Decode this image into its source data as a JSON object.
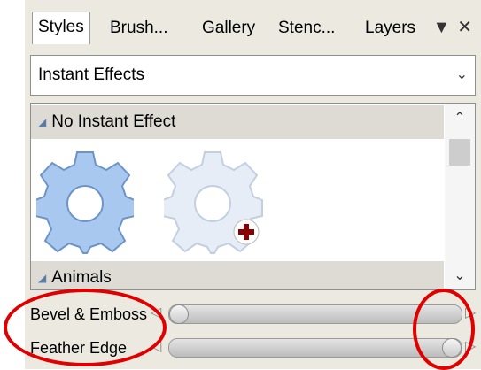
{
  "tabs": [
    {
      "label": "Styles",
      "active": true
    },
    {
      "label": "Brush...",
      "active": false
    },
    {
      "label": "Gallery",
      "active": false
    },
    {
      "label": "Stenc...",
      "active": false
    },
    {
      "label": "Layers",
      "active": false
    }
  ],
  "tab_menu_icon": "triangle-down-icon",
  "close_icon": "close-icon",
  "effects_dropdown": {
    "value": "Instant Effects"
  },
  "gallery": {
    "groups": [
      {
        "label": "No Instant Effect"
      },
      {
        "label": "Animals"
      }
    ],
    "tiles": [
      {
        "name": "gear-style-icon",
        "color": "#a9c8f0"
      },
      {
        "name": "gear-add-style-icon",
        "color": "#e6edf7",
        "badge_color": "#8b0000"
      }
    ]
  },
  "sliders": [
    {
      "label": "Bevel & Emboss",
      "value_fraction": 0.0
    },
    {
      "label": "Feather Edge",
      "value_fraction": 1.0
    }
  ],
  "colors": {
    "annotation": "#e00000",
    "panel_bg": "#ece9e1",
    "accent_blue": "#5b7ba8"
  }
}
